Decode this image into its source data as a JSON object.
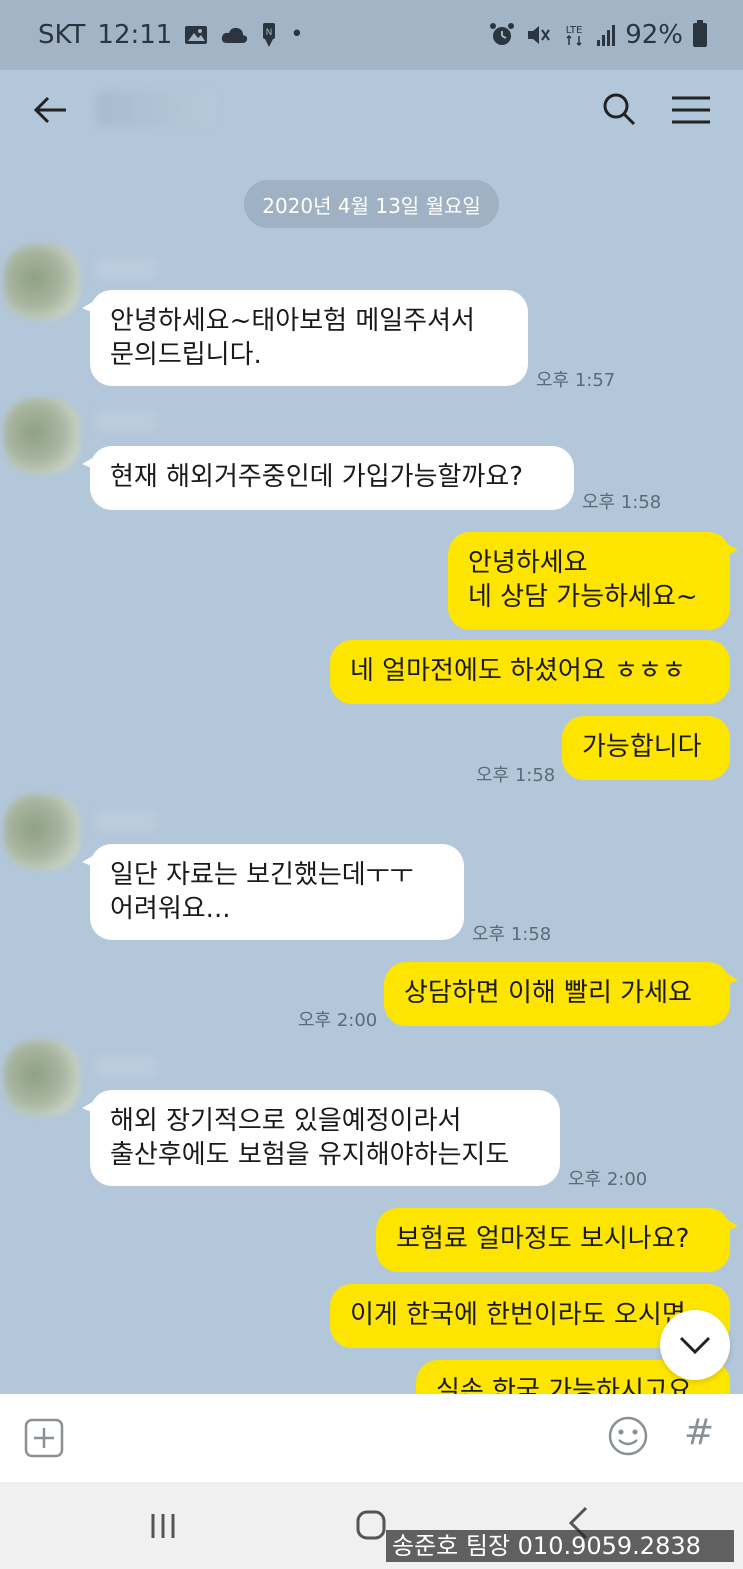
{
  "status_bar": {
    "carrier": "SKT",
    "time": "12:11",
    "network": "LTE",
    "battery": "92%",
    "icons": [
      "image-icon",
      "cloud-icon",
      "notification-icon",
      "alarm-icon",
      "mute-icon",
      "lte-icon",
      "signal-icon",
      "battery-icon"
    ]
  },
  "header": {
    "title": "",
    "icons": [
      "back-arrow-icon",
      "search-icon",
      "menu-icon"
    ]
  },
  "date_divider": "2020년 4월 13일 월요일",
  "messages": [
    {
      "side": "in",
      "text": "안녕하세요~태아보험 메일주셔서\n문의드립니다.",
      "time": "오후 1:57"
    },
    {
      "side": "in",
      "text": "현재 해외거주중인데 가입가능할까요?",
      "time": "오후 1:58"
    },
    {
      "side": "out",
      "text": "안녕하세요\n네 상담 가능하세요~",
      "time": ""
    },
    {
      "side": "out",
      "text": "네 얼마전에도 하셨어요 ㅎㅎㅎ",
      "time": ""
    },
    {
      "side": "out",
      "text": "가능합니다",
      "time": "오후 1:58"
    },
    {
      "side": "in",
      "text": "일단 자료는 보긴했는데ㅜㅜ\n어려워요...",
      "time": "오후 1:58"
    },
    {
      "side": "out",
      "text": "상담하면 이해 빨리 가세요",
      "time": "오후 2:00"
    },
    {
      "side": "in",
      "text": "해외  장기적으로 있을예정이라서\n출산후에도 보험을 유지해야하는지도",
      "time": "오후 2:00"
    },
    {
      "side": "out",
      "text": "보험료 얼마정도 보시나요?",
      "time": ""
    },
    {
      "side": "out",
      "text": "이게 한국에 한번이라도 오시면",
      "time": ""
    },
    {
      "side": "out",
      "text": "실손 한국 가능하시고요",
      "time": ""
    }
  ],
  "input_bar": {
    "icons": [
      "plus-icon",
      "emoji-icon",
      "hashtag-icon"
    ],
    "hash_label": "#"
  },
  "nav_bar": {
    "icons": [
      "recent-apps-icon",
      "home-icon",
      "back-icon"
    ]
  },
  "watermark": "송준호 팀장 010.9059.2838",
  "colors": {
    "chat_background": "#b2c7da",
    "incoming_bubble": "#ffffff",
    "outgoing_bubble": "#fee500",
    "status_bar": "#a2b4c5",
    "date_pill": "#9fb1c2"
  }
}
